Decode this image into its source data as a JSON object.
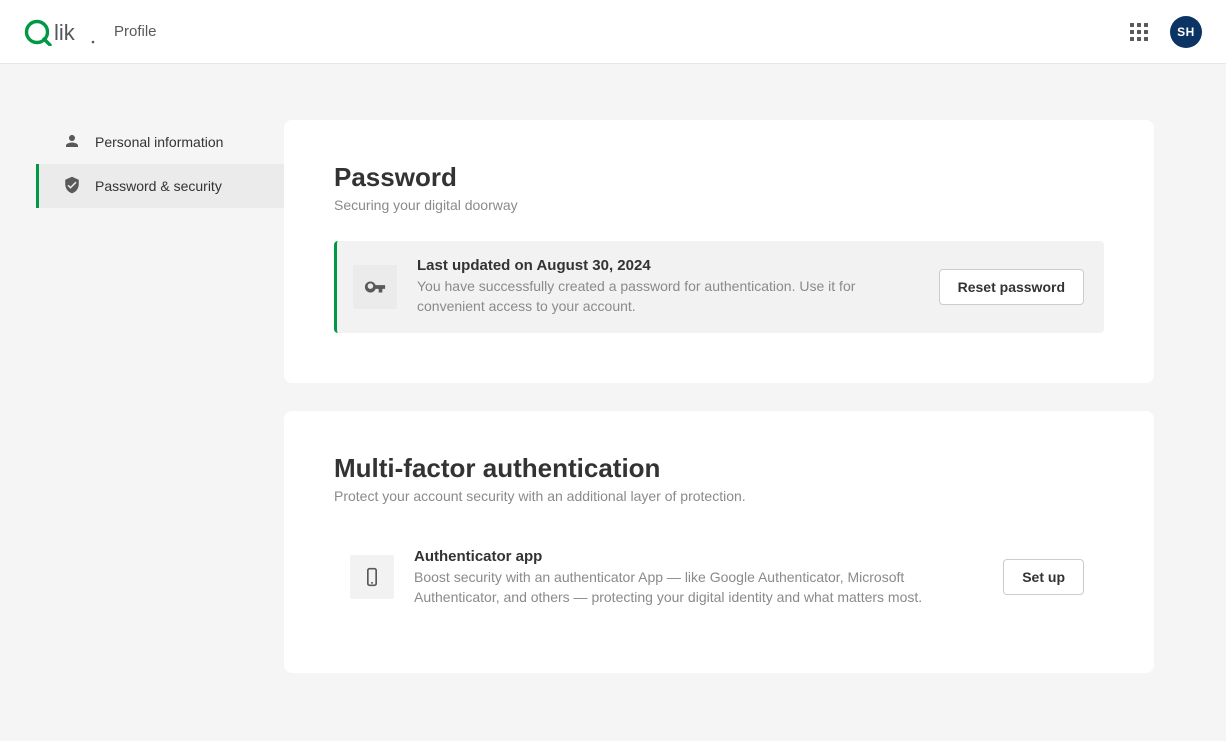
{
  "header": {
    "page_label": "Profile",
    "avatar_initials": "SH"
  },
  "sidebar": {
    "items": [
      {
        "label": "Personal information"
      },
      {
        "label": "Password & security"
      }
    ]
  },
  "password_section": {
    "title": "Password",
    "subtitle": "Securing your digital doorway",
    "status_title": "Last updated on August 30, 2024",
    "status_desc": "You have successfully created a password for authentication. Use it for convenient access to your account.",
    "button_label": "Reset password"
  },
  "mfa_section": {
    "title": "Multi-factor authentication",
    "subtitle": "Protect your account security with an additional layer of protection.",
    "app_title": "Authenticator app",
    "app_desc": "Boost security with an authenticator App — like Google Authenticator, Microsoft Authenticator, and others — protecting your digital identity and what matters most.",
    "button_label": "Set up"
  }
}
